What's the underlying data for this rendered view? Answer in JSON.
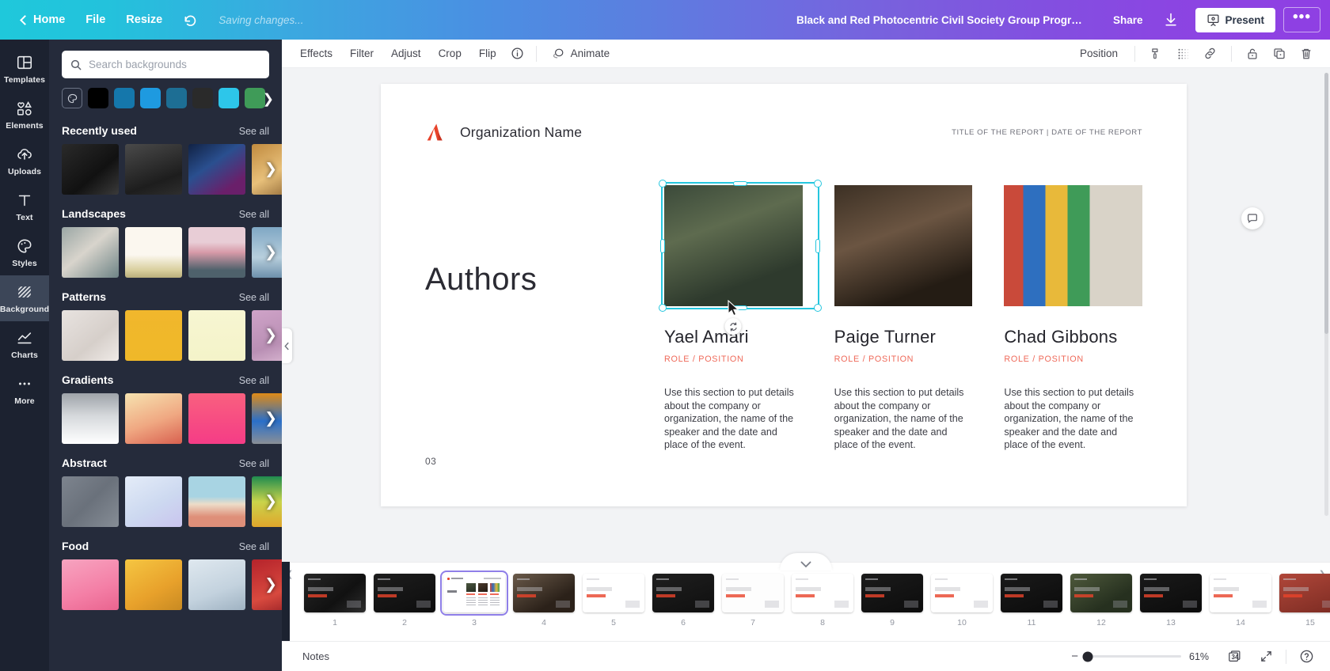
{
  "topbar": {
    "back_label": "",
    "home_label": "Home",
    "file_label": "File",
    "resize_label": "Resize",
    "undo_label": "",
    "saving_status": "Saving changes...",
    "doc_title": "Black and Red Photocentric Civil Society Group Progress Re...",
    "share_label": "Share",
    "download_label": "",
    "present_label": "Present",
    "more_label": "•••",
    "gradient_start": "#1fc8db",
    "gradient_end": "#8f3fe3"
  },
  "rail": {
    "items": [
      {
        "label": "Templates",
        "icon": "templates-icon",
        "active": false
      },
      {
        "label": "Elements",
        "icon": "elements-icon",
        "active": false
      },
      {
        "label": "Uploads",
        "icon": "uploads-icon",
        "active": false
      },
      {
        "label": "Text",
        "icon": "text-icon",
        "active": false
      },
      {
        "label": "Styles",
        "icon": "styles-icon",
        "active": false
      },
      {
        "label": "Background",
        "icon": "background-icon",
        "active": true
      },
      {
        "label": "Charts",
        "icon": "charts-icon",
        "active": false
      },
      {
        "label": "More",
        "icon": "more-icon",
        "active": false
      }
    ]
  },
  "panel": {
    "search_placeholder": "Search backgrounds",
    "search_value": "",
    "swatches": [
      {
        "name": "color-picker",
        "color": ""
      },
      {
        "name": "swatch-black",
        "color": "#000000"
      },
      {
        "name": "swatch-steel-blue",
        "color": "#1577ab"
      },
      {
        "name": "swatch-bright-blue",
        "color": "#1e9ae0"
      },
      {
        "name": "swatch-dark-teal",
        "color": "#1d6e94"
      },
      {
        "name": "swatch-charcoal",
        "color": "#2a2a2a"
      },
      {
        "name": "swatch-cyan",
        "color": "#2dc6ea"
      },
      {
        "name": "swatch-green",
        "color": "#3f9b58"
      }
    ],
    "sections": [
      {
        "title": "Recently used",
        "see_all": "See all",
        "thumbs": [
          "linear-gradient(140deg,#2a2a2a,#111 60%,#3a3a3a)",
          "linear-gradient(160deg,#4a4a4a,#1d1d1d 70%,#2e2e2e)",
          "linear-gradient(145deg,#112244,#2a4f8f 40%,#6a1f6a 80%)",
          "linear-gradient(150deg,#c08a3e,#e8c07a 50%,#7a5224)"
        ]
      },
      {
        "title": "Landscapes",
        "see_all": "See all",
        "thumbs": [
          "linear-gradient(140deg,#9aa6a4,#d8d4cc 45%,#6e8486)",
          "linear-gradient(180deg,#fbf7ef 55%,#d9cf9d 85%,#b9ae7b)",
          "linear-gradient(180deg,#e8cdd6 30%,#d79aa8 50%,#4e616b 85%)",
          "linear-gradient(180deg,#7fa7c4,#b8cfdd 60%,#6d90ab)"
        ]
      },
      {
        "title": "Patterns",
        "see_all": "See all",
        "thumbs": [
          "linear-gradient(140deg,#e8e3e0,#d6cfca 60%,#efeae7)",
          "linear-gradient(180deg,#f1b72c,#efb829)",
          "linear-gradient(180deg,#f7f6d2,#f4f3c9)",
          "linear-gradient(160deg,#cfa3c8,#b98fb4 60%,#e0c0d8)"
        ]
      },
      {
        "title": "Gradients",
        "see_all": "See all",
        "thumbs": [
          "linear-gradient(180deg,#9ea3a9,#d6d9dc 45%,#ffffff)",
          "linear-gradient(160deg,#f6e3b0,#f0a882 55%,#d8604f)",
          "linear-gradient(180deg,#f9607f,#f53c86)",
          "linear-gradient(180deg,#e08b16,#2a6fc9 55%,#8a8f96)"
        ]
      },
      {
        "title": "Abstract",
        "see_all": "See all",
        "thumbs": [
          "linear-gradient(135deg,#7d848e,#6a717b 50%,#868d96)",
          "linear-gradient(150deg,#e4ecf8,#cdd9f0 55%,#c9c4ee)",
          "linear-gradient(180deg,#a8d4e3 40%,#eddcc8 55%,#de8f79 80%)",
          "linear-gradient(180deg,#1f8c4f,#c9d44b 50%,#e0a62c)"
        ]
      },
      {
        "title": "Food",
        "see_all": "See all",
        "thumbs": [
          "linear-gradient(160deg,#f7a4c0,#f47fa6 60%,#e9648f)",
          "linear-gradient(150deg,#f5c642,#e8a12b 60%,#c88a22)",
          "linear-gradient(160deg,#dfe8ef,#c3d2de 60%,#9fb2c2)",
          "linear-gradient(160deg,#b5232b,#d94a3f 60%,#8f1c22)"
        ]
      }
    ]
  },
  "edtoolbar": {
    "items": [
      "Effects",
      "Filter",
      "Adjust",
      "Crop",
      "Flip"
    ],
    "info_icon": "info-icon",
    "animate_label": "Animate",
    "animate_icon": "animate-icon",
    "position_label": "Position",
    "right_icons": [
      "transparency-icon",
      "duotone-icon",
      "link-icon",
      "lock-icon",
      "duplicate-icon",
      "delete-icon"
    ]
  },
  "slide": {
    "org_name": "Organization Name",
    "report_meta": "TITLE OF THE REPORT | DATE OF THE REPORT",
    "section_title": "Authors",
    "page_number": "03",
    "accent_color": "#e8432b",
    "role_color": "#ef6a5a",
    "authors": [
      {
        "name": "Yael Amari",
        "role": "ROLE / POSITION",
        "description": "Use this section to put details about the company or organization, the name of the speaker and the date and place of the event.",
        "photo": "linear-gradient(160deg,#3b4a3a,#5e6b4f 35%,#2e3a2d 75%)",
        "selected": true
      },
      {
        "name": "Paige Turner",
        "role": "ROLE / POSITION",
        "description": "Use this section to put details about the company or organization, the name of the speaker and the date and place of the event.",
        "photo": "linear-gradient(160deg,#3c3024,#6b5542 40%,#241c14 80%)",
        "selected": false
      },
      {
        "name": "Chad Gibbons",
        "role": "ROLE / POSITION",
        "description": "Use this section to put details about the company or organization, the name of the speaker and the date and place of the event.",
        "photo": "linear-gradient(90deg,#c94a3a 0 14%,#2e6fbf 14% 30%,#e8b93a 30% 46%,#3f9b58 46% 62%,#d9d3c8 62% 100%)",
        "selected": false
      }
    ]
  },
  "pagestrip": {
    "pages": [
      {
        "num": "1",
        "bg": "linear-gradient(140deg,#262626,#111 60%,#2e2e2e)",
        "selected": false
      },
      {
        "num": "2",
        "bg": "linear-gradient(160deg,#1d1d1d,#0d0d0d)",
        "selected": false
      },
      {
        "num": "3",
        "bg": "#ffffff",
        "selected": true
      },
      {
        "num": "4",
        "bg": "linear-gradient(150deg,#6a5a4a,#2b2119 70%)",
        "selected": false
      },
      {
        "num": "5",
        "bg": "#ffffff",
        "selected": false
      },
      {
        "num": "6",
        "bg": "linear-gradient(160deg,#1f1f1f,#0f0f0f)",
        "selected": false
      },
      {
        "num": "7",
        "bg": "#fdfdfd",
        "selected": false
      },
      {
        "num": "8",
        "bg": "#ffffff",
        "selected": false
      },
      {
        "num": "9",
        "bg": "linear-gradient(160deg,#1b1b1b,#0c0c0c)",
        "selected": false
      },
      {
        "num": "10",
        "bg": "#ffffff",
        "selected": false
      },
      {
        "num": "11",
        "bg": "linear-gradient(160deg,#1a1a1a,#0b0b0b)",
        "selected": false
      },
      {
        "num": "12",
        "bg": "linear-gradient(150deg,#4f5a3c,#26301f 70%)",
        "selected": false
      },
      {
        "num": "13",
        "bg": "linear-gradient(160deg,#1a1a1a,#0b0b0b)",
        "selected": false
      },
      {
        "num": "14",
        "bg": "#ffffff",
        "selected": false
      },
      {
        "num": "15",
        "bg": "linear-gradient(160deg,#b0473a,#7b2b22)",
        "selected": false
      }
    ]
  },
  "bottombar": {
    "notes_label": "Notes",
    "zoom_minus": "−",
    "zoom_value": "61%",
    "page_count": "34",
    "fullscreen_icon": "fullscreen-icon",
    "help_icon": "help-icon"
  }
}
